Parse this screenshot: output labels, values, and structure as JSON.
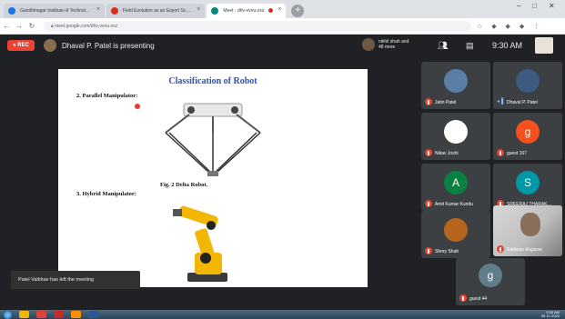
{
  "browser": {
    "tabs": [
      {
        "label": "Gandhinagar Institute of Technol…",
        "active": false,
        "color": "#1a73e8"
      },
      {
        "label": "Field Evolution as an Expert Sc…",
        "active": false,
        "color": "#d93025"
      },
      {
        "label": "Meet - dhv-vvnu-zsz",
        "active": true,
        "color": "#00897b"
      }
    ],
    "url": "meet.google.com/dhv-vvnu-zsz"
  },
  "meet": {
    "rec_label": "REC",
    "presenting_text": "Dhaval P. Patel is presenting",
    "joined_text": "nikhil shah and 48 more",
    "clock": "9:30 AM",
    "toast": "Patel Vaibhav has left the meeting"
  },
  "slide": {
    "title": "Classification of Robot",
    "section1": "2.   Parallel Manipulator:",
    "caption1": "Fig. 2 Delta Robot.",
    "section2": "3.   Hybrid Manipulator:"
  },
  "participants": [
    {
      "name": "Jatin Patel",
      "kind": "photo",
      "bg": "#5a7fa6",
      "muted": true
    },
    {
      "name": "Dhaval P. Patel",
      "kind": "photo",
      "bg": "#3d5a80",
      "muted": false
    },
    {
      "name": "Nikav Joshi",
      "kind": "photo",
      "bg": "#ffffff",
      "muted": true
    },
    {
      "name": "guest 167",
      "kind": "letter",
      "letter": "g",
      "bg": "#f4511e",
      "muted": true
    },
    {
      "name": "Amit Kumar Kundu",
      "kind": "letter",
      "letter": "A",
      "bg": "#0b8043",
      "muted": true
    },
    {
      "name": "SREERAJ THARAK…",
      "kind": "letter",
      "letter": "S",
      "bg": "#0097a7",
      "muted": true
    },
    {
      "name": "Shrey Shah",
      "kind": "photo",
      "bg": "#b5651d",
      "muted": true
    },
    {
      "name": "Sarfaraz Mujawar",
      "kind": "video",
      "muted": true
    },
    {
      "name": "guest 44",
      "kind": "letter",
      "letter": "g",
      "bg": "#607d8b",
      "muted": true
    }
  ],
  "taskbar": {
    "time": "9:30 AM",
    "date": "09-11-2020"
  },
  "colors": {
    "meet_bg": "#202124",
    "rec_red": "#ea4335",
    "slide_title_blue": "#2a52be"
  }
}
